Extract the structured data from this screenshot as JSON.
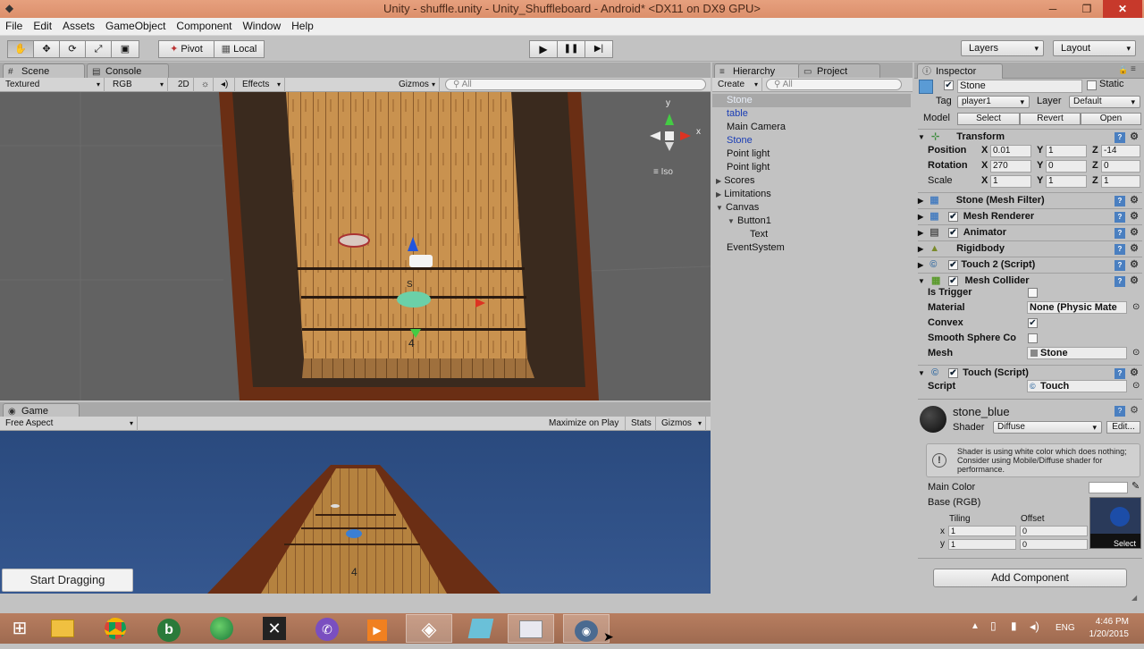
{
  "window": {
    "title": "Unity - shuffle.unity - Unity_Shuffleboard - Android* <DX11 on DX9 GPU>",
    "logo": "unity-logo-icon",
    "min": "─",
    "max": "❐",
    "close": "✕"
  },
  "menu": [
    "File",
    "Edit",
    "Assets",
    "GameObject",
    "Component",
    "Window",
    "Help"
  ],
  "toolbar": {
    "tools": [
      "hand-icon",
      "move-icon",
      "rotate-icon",
      "scale-icon",
      "rect-icon"
    ],
    "pivot": "Pivot",
    "local": "Local",
    "layers": "Layers",
    "layout": "Layout",
    "play": "▶",
    "pause": "❚❚",
    "step": "▶|"
  },
  "scene": {
    "tab": "Scene",
    "tab2": "Console",
    "shading": "Textured",
    "channel": "RGB",
    "mode2d": "2D",
    "effects": "Effects",
    "gizmos": "Gizmos",
    "search": "All",
    "iso": "Iso",
    "gizmo_x": "x",
    "gizmo_y": "y"
  },
  "game": {
    "tab": "Game",
    "aspect": "Free Aspect",
    "maximize": "Maximize on Play",
    "stats": "Stats",
    "gizmos": "Gizmos",
    "button": "Start Dragging"
  },
  "hierarchy": {
    "tab": "Hierarchy",
    "tab2": "Project",
    "create": "Create",
    "search": "All",
    "items": [
      {
        "label": "Stone",
        "selected": true
      },
      {
        "label": "table",
        "blue": true
      },
      {
        "label": "Main Camera"
      },
      {
        "label": "Stone",
        "blue": true
      },
      {
        "label": "Point light"
      },
      {
        "label": "Point light"
      },
      {
        "label": "Scores",
        "arrow": "▶"
      },
      {
        "label": "Limitations",
        "arrow": "▶"
      },
      {
        "label": "Canvas",
        "arrow": "▼"
      },
      {
        "label": "Button1",
        "arrow": "▼"
      },
      {
        "label": "Text"
      },
      {
        "label": "EventSystem"
      }
    ]
  },
  "inspector": {
    "tab": "Inspector",
    "name": "Stone",
    "static": "Static",
    "tag_label": "Tag",
    "tag": "player1",
    "layer_label": "Layer",
    "layer": "Default",
    "model": "Model",
    "select": "Select",
    "revert": "Revert",
    "open": "Open",
    "transform": {
      "title": "Transform",
      "position": "Position",
      "rotation": "Rotation",
      "scale": "Scale",
      "px": "0.01",
      "py": "1",
      "pz": "-14",
      "rx": "270",
      "ry": "0",
      "rz": "0",
      "sx": "1",
      "sy": "1",
      "sz": "1",
      "x": "X",
      "y": "Y",
      "z": "Z"
    },
    "components": [
      "Stone (Mesh Filter)",
      "Mesh Renderer",
      "Animator",
      "Rigidbody",
      "Touch 2 (Script)",
      "Mesh Collider"
    ],
    "collider": {
      "is_trigger": "Is Trigger",
      "material": "Material",
      "material_val": "None (Physic Mate",
      "convex": "Convex",
      "smooth": "Smooth Sphere Co",
      "mesh": "Mesh",
      "mesh_val": "Stone"
    },
    "touch": {
      "title": "Touch (Script)",
      "script": "Script",
      "script_val": "Touch"
    },
    "material": {
      "name": "stone_blue",
      "shader_label": "Shader",
      "shader": "Diffuse",
      "edit": "Edit...",
      "warning": "Shader is using white color which does nothing; Consider using Mobile/Diffuse shader for performance.",
      "main_color": "Main Color",
      "base": "Base (RGB)",
      "tiling": "Tiling",
      "offset": "Offset",
      "tx": "1",
      "ty": "1",
      "ox": "0",
      "oy": "0",
      "x": "x",
      "y": "y",
      "select": "Select"
    },
    "add_component": "Add Component"
  },
  "taskbar": {
    "icons": [
      "windows-start-icon",
      "file-explorer-icon",
      "chrome-icon",
      "bing-icon",
      "globe-icon",
      "xcode-icon",
      "viber-icon",
      "media-player-icon",
      "unity-icon",
      "notes-icon",
      "folder-icon",
      "unity-remote-icon"
    ],
    "lang": "ENG",
    "time": "4:46 PM",
    "date": "1/20/2015"
  }
}
